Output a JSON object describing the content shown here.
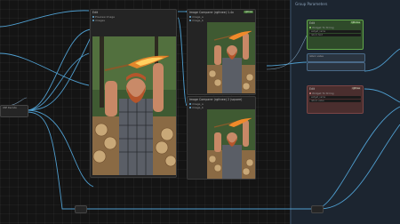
{
  "nodes": {
    "left_stub": {
      "label": "VAE Decode"
    },
    "main_image": {
      "title": "Edit",
      "rows": [
        "Preview Image",
        "images"
      ]
    },
    "top_right_image": {
      "title": "Image Comparer (rgthree) 1.4x",
      "badge": "rgthree",
      "rows": [
        "image_a",
        "image_b"
      ]
    },
    "bottom_right_image": {
      "title": "Image Comparer (rgthree) 2 (square)",
      "rows": [
        "image_a",
        "image_b"
      ]
    },
    "right_top": {
      "title": "Edit",
      "badge": "KJNodes",
      "rows": [
        "Widget To String",
        "widget_name"
      ],
      "fields": [
        "",
        "return text",
        "return value"
      ]
    },
    "right_mid": {
      "title": "Edit",
      "badge": "rgthree",
      "rows": [
        "Widget To String",
        "widget_name"
      ],
      "fields": [
        "",
        "return value"
      ]
    }
  },
  "right_group": {
    "title": "Group Parameters"
  },
  "colors": {
    "wire": "#4f9ecf",
    "wire_alt": "#8fb8d8",
    "green": "#62a94a"
  },
  "icons": [
    "node-connector-dot"
  ]
}
